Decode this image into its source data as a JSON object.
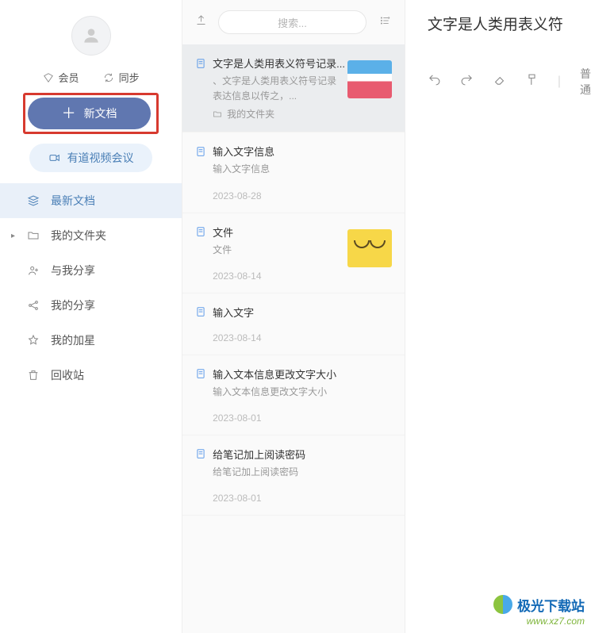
{
  "sidebar": {
    "member_label": "会员",
    "sync_label": "同步",
    "new_doc_label": "新文档",
    "video_meet_label": "有道视频会议",
    "nav": [
      {
        "label": "最新文档"
      },
      {
        "label": "我的文件夹"
      },
      {
        "label": "与我分享"
      },
      {
        "label": "我的分享"
      },
      {
        "label": "我的加星"
      },
      {
        "label": "回收站"
      }
    ]
  },
  "list": {
    "search_placeholder": "搜索...",
    "items": [
      {
        "title": "文字是人类用表义符号记录...",
        "preview": "、文字是人类用表义符号记录表达信息以传之，...",
        "folder": "我的文件夹",
        "date": ""
      },
      {
        "title": "输入文字信息",
        "preview": "输入文字信息",
        "date": "2023-08-28"
      },
      {
        "title": "文件",
        "preview": "文件",
        "date": "2023-08-14"
      },
      {
        "title": "输入文字",
        "preview": "",
        "date": "2023-08-14"
      },
      {
        "title": "输入文本信息更改文字大小",
        "preview": "输入文本信息更改文字大小",
        "date": "2023-08-01"
      },
      {
        "title": "给笔记加上阅读密码",
        "preview": "给笔记加上阅读密码",
        "date": "2023-08-01"
      }
    ]
  },
  "doc": {
    "title": "文字是人类用表义符",
    "toolbar_text": "普通"
  },
  "watermark": {
    "brand": "极光下载站",
    "url": "www.xz7.com"
  }
}
